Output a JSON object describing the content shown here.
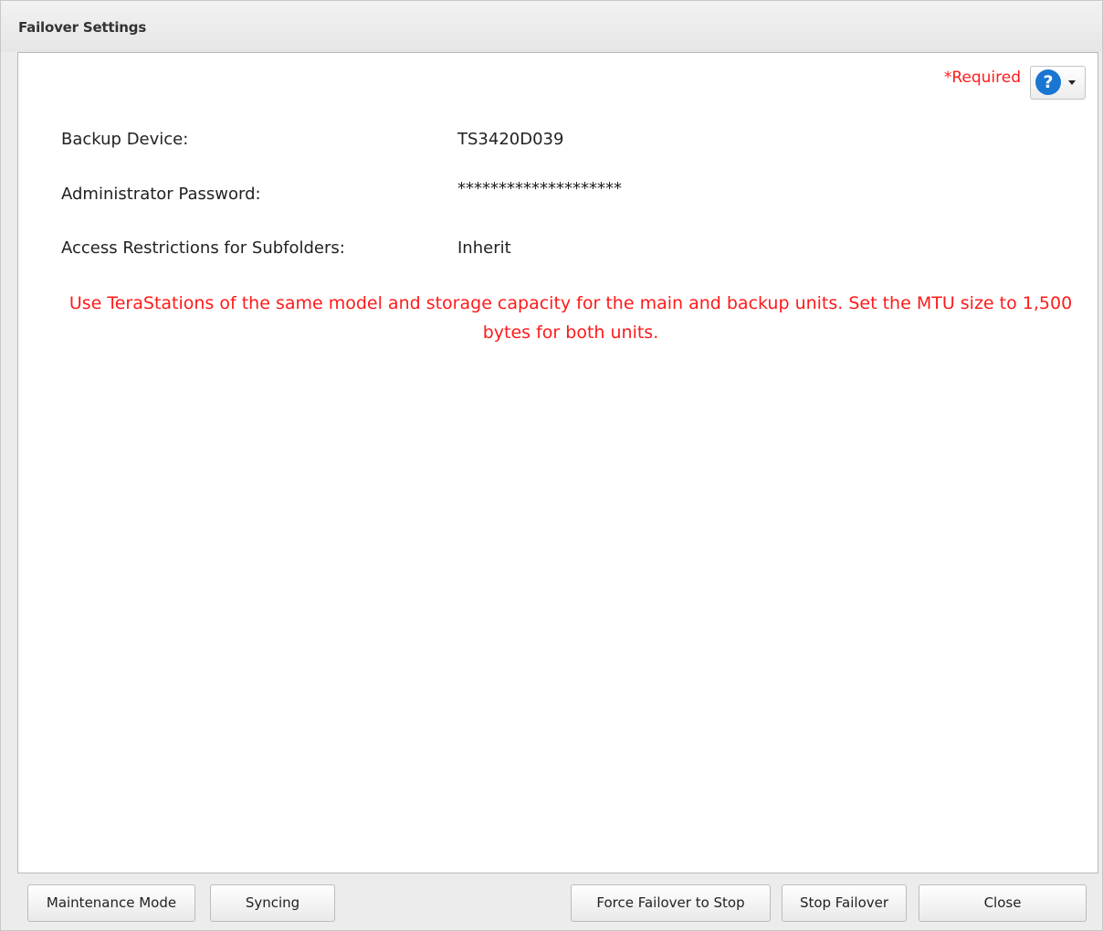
{
  "window": {
    "title": "Failover Settings"
  },
  "header": {
    "required_label": "*Required",
    "help_icon": "question-circle-icon",
    "help_glyph": "?",
    "help_dropdown_icon": "caret-down-icon"
  },
  "fields": [
    {
      "label": "Backup Device:",
      "value": "TS3420D039"
    },
    {
      "label": "Administrator Password:",
      "value": "********************"
    },
    {
      "label": "Access Restrictions for Subfolders:",
      "value": "Inherit"
    }
  ],
  "notice": "Use TeraStations of the same model and storage capacity for the main and backup units. Set the MTU size to 1,500 bytes for both units.",
  "buttons": {
    "maintenance_mode": "Maintenance Mode",
    "syncing": "Syncing",
    "force_failover_to_stop": "Force Failover to Stop",
    "stop_failover": "Stop Failover",
    "close": "Close"
  },
  "colors": {
    "warning_text": "#ff1a1a",
    "help_icon": "#1976d2"
  }
}
